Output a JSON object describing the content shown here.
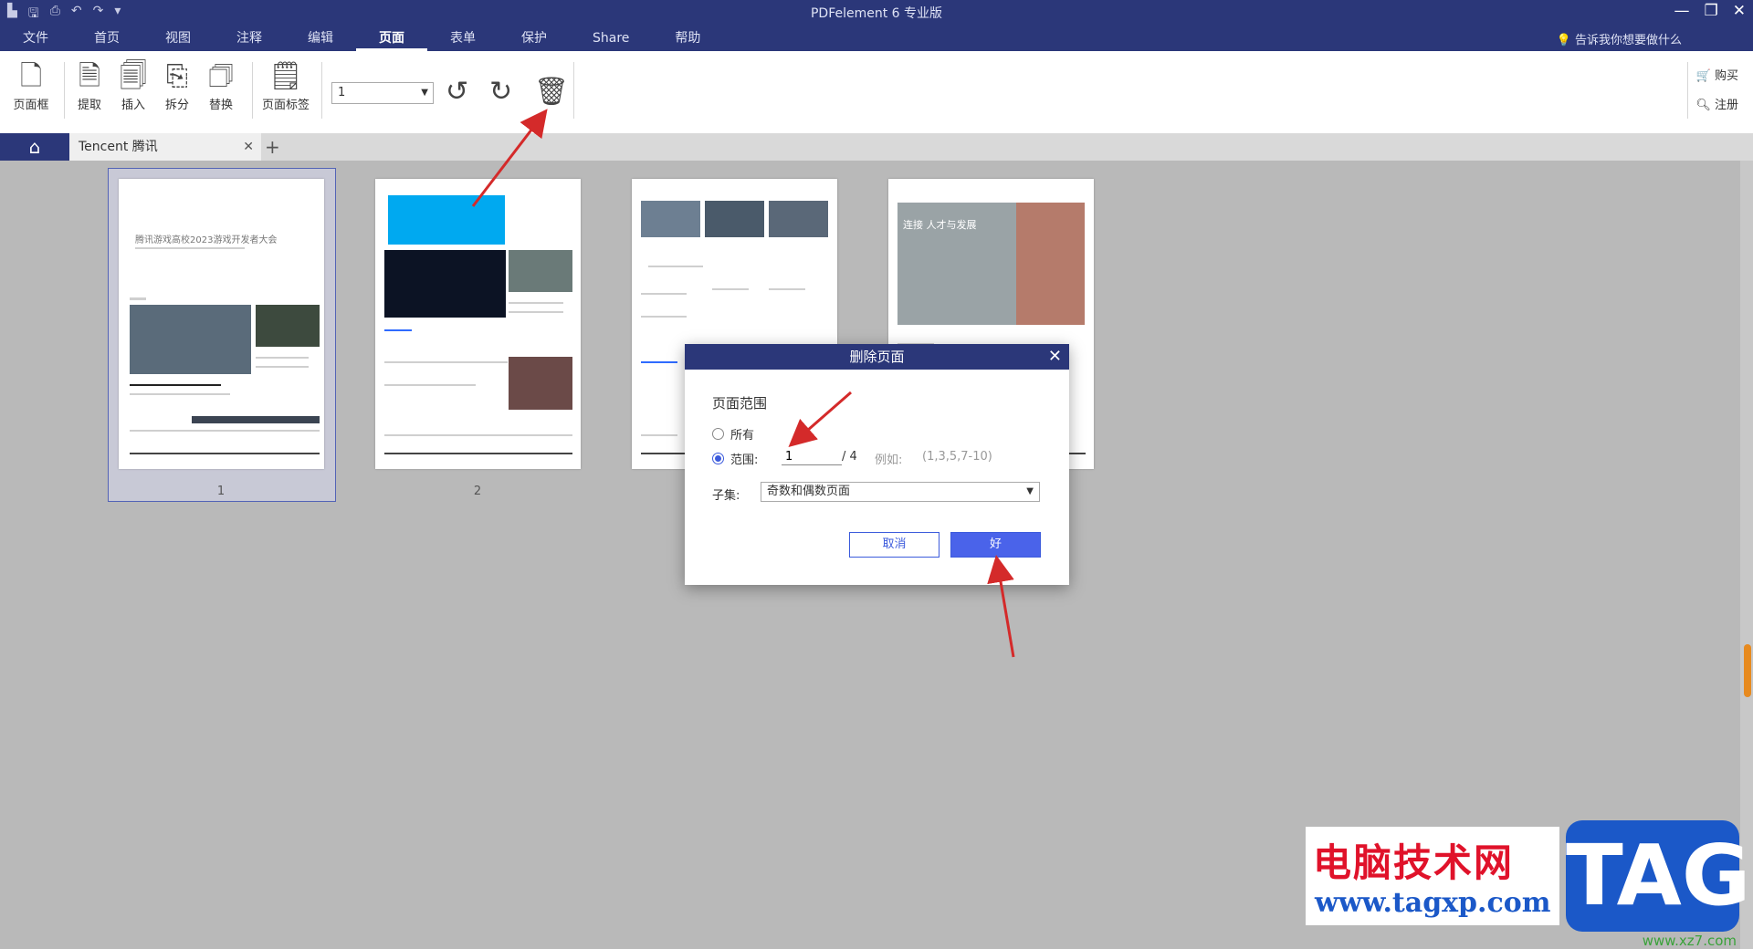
{
  "app": {
    "title": "PDFelement 6 专业版",
    "menu": [
      "文件",
      "首页",
      "视图",
      "注释",
      "编辑",
      "页面",
      "表单",
      "保护",
      "Share",
      "帮助"
    ],
    "active_menu": "页面",
    "tell_me": "告诉我你想要做什么"
  },
  "ribbon": {
    "page_frame": "页面框",
    "extract": "提取",
    "insert": "插入",
    "split": "拆分",
    "replace": "替换",
    "page_label": "页面标签",
    "page_select_value": "1",
    "buy": "购买",
    "register": "注册"
  },
  "tabs": {
    "doc_tab": "Tencent 腾讯"
  },
  "thumbnails": {
    "page1_title": "腾讯游戏高校2023游戏开发者大会",
    "page1_num": "1",
    "page2_num": "2",
    "page4_title": "连接 人才与发展"
  },
  "dialog": {
    "title": "删除页面",
    "section": "页面范围",
    "all_label": "所有",
    "range_label": "范围:",
    "range_value": "1",
    "total": "/ 4",
    "example_label": "例如:",
    "example": "(1,3,5,7-10)",
    "subset_label": "子集:",
    "subset_value": "奇数和偶数页面",
    "cancel": "取消",
    "ok": "好"
  },
  "watermark": {
    "cn": "电脑技术网",
    "url": "www.tagxp.com",
    "tag": "TAG",
    "small": "www.xz7.com"
  },
  "colors": {
    "titlebar": "#2b3779",
    "accent": "#4a63ea",
    "arrow": "#d42a2a"
  }
}
